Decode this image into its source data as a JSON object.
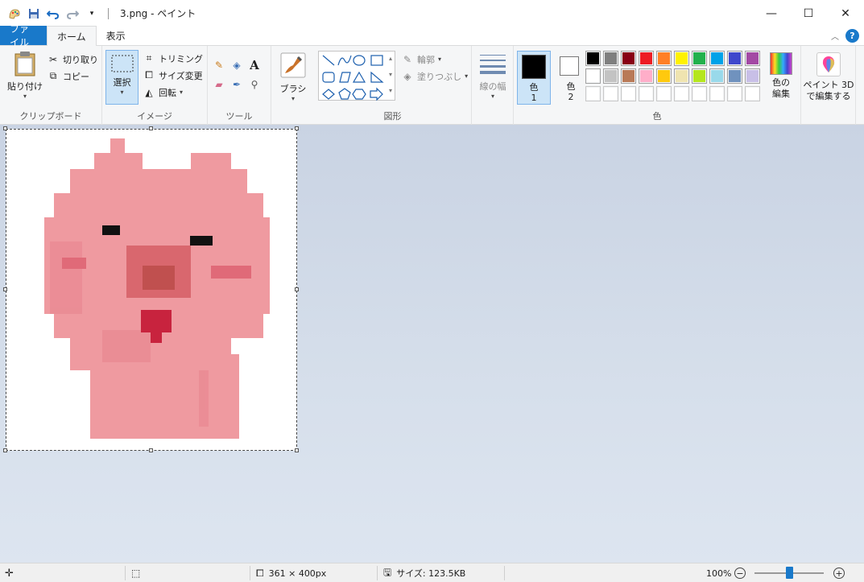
{
  "title_bar": {
    "title": "3.png - ペイント",
    "undo_icon": "undo-icon",
    "redo_icon": "redo-icon",
    "save_icon": "save-icon"
  },
  "tabs": [
    {
      "label": "ファイル"
    },
    {
      "label": "ホーム"
    },
    {
      "label": "表示"
    }
  ],
  "clipboard": {
    "paste": "貼り付け",
    "cut": "切り取り",
    "copy": "コピー",
    "group": "クリップボード"
  },
  "image": {
    "select": "選択",
    "crop": "トリミング",
    "resize": "サイズ変更",
    "rotate": "回転",
    "group": "イメージ"
  },
  "tools": {
    "group": "ツール",
    "text_glyph": "A"
  },
  "brushes": {
    "label": "ブラシ"
  },
  "shapes": {
    "outline": "輪郭",
    "fill": "塗りつぶし",
    "group": "図形"
  },
  "size": {
    "label": "線の幅"
  },
  "colors": {
    "color1_label": "色",
    "color1_num": "1",
    "color2_label": "色",
    "color2_num": "2",
    "edit_label_1": "色の",
    "edit_label_2": "編集",
    "group": "色",
    "color1": "#000000",
    "color2": "#ffffff",
    "palette_row1": [
      "#000000",
      "#7f7f7f",
      "#880015",
      "#ed1c24",
      "#ff7f27",
      "#fff200",
      "#22b14c",
      "#00a2e8",
      "#3f48cc",
      "#a349a4"
    ],
    "palette_row2": [
      "#ffffff",
      "#c3c3c3",
      "#b97a57",
      "#ffaec9",
      "#ffc90e",
      "#efe4b0",
      "#b5e61d",
      "#99d9ea",
      "#7092be",
      "#c8bfe7"
    ],
    "palette_row3": [
      "#ffffff",
      "#ffffff",
      "#ffffff",
      "#ffffff",
      "#ffffff",
      "#ffffff",
      "#ffffff",
      "#ffffff",
      "#ffffff",
      "#ffffff"
    ]
  },
  "paint3d": {
    "line1": "ペイント 3D",
    "line2": "で編集する"
  },
  "status": {
    "dimensions": "361 × 400px",
    "size": "サイズ: 123.5KB",
    "zoom": "100%",
    "zoom_level": 1.0
  }
}
